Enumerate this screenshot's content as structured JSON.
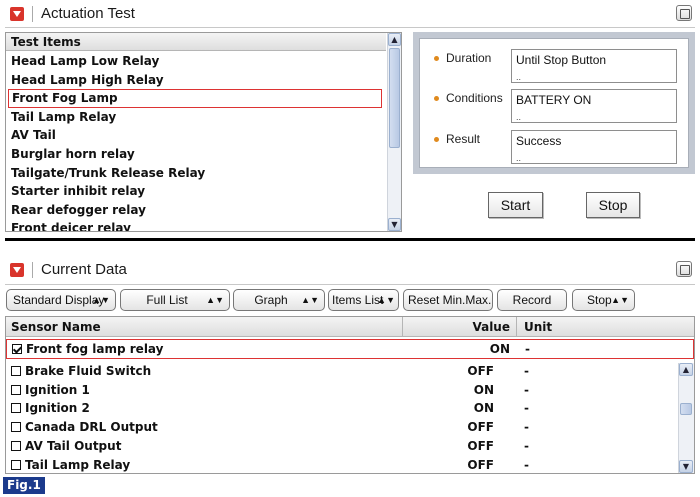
{
  "actuation": {
    "title": "Actuation Test",
    "list_header": "Test Items",
    "items": [
      "Head Lamp Low Relay",
      "Head Lamp High Relay",
      "Front Fog Lamp",
      "Tail Lamp Relay",
      "AV Tail",
      "Burglar horn relay",
      "Tailgate/Trunk Release Relay",
      "Starter inhibit relay",
      "Rear defogger relay",
      "Front deicer relay"
    ],
    "selected_index": 2,
    "info": {
      "duration_label": "Duration",
      "duration_value": "Until Stop Button",
      "conditions_label": "Conditions",
      "conditions_value": "BATTERY ON",
      "result_label": "Result",
      "result_value": "Success"
    },
    "start_label": "Start",
    "stop_label": "Stop"
  },
  "current_data": {
    "title": "Current Data",
    "toolbar": {
      "standard_display": "Standard Display",
      "full_list": "Full List",
      "graph": "Graph",
      "items_list": "Items List",
      "reset_minmax": "Reset Min.Max.",
      "record": "Record",
      "stop": "Stop"
    },
    "columns": {
      "sensor_name": "Sensor Name",
      "value": "Value",
      "unit": "Unit"
    },
    "pinned_row": {
      "name": "Front fog lamp relay",
      "value": "ON",
      "unit": "-",
      "checked": true
    },
    "rows": [
      {
        "name": "Brake Fluid Switch",
        "value": "OFF",
        "unit": "-",
        "checked": false
      },
      {
        "name": "Ignition 1",
        "value": "ON",
        "unit": "-",
        "checked": false
      },
      {
        "name": "Ignition 2",
        "value": "ON",
        "unit": "-",
        "checked": false
      },
      {
        "name": "Canada DRL Output",
        "value": "OFF",
        "unit": "-",
        "checked": false
      },
      {
        "name": "AV Tail Output",
        "value": "OFF",
        "unit": "-",
        "checked": false
      },
      {
        "name": "Tail Lamp Relay",
        "value": "OFF",
        "unit": "-",
        "checked": false
      }
    ]
  },
  "figure_label": "Fig.1",
  "colors": {
    "collapse_button": "#d9342b",
    "selection_border": "#dd3333",
    "bullet": "#e08a1e",
    "figure_label_bg": "#1b3a8c"
  }
}
